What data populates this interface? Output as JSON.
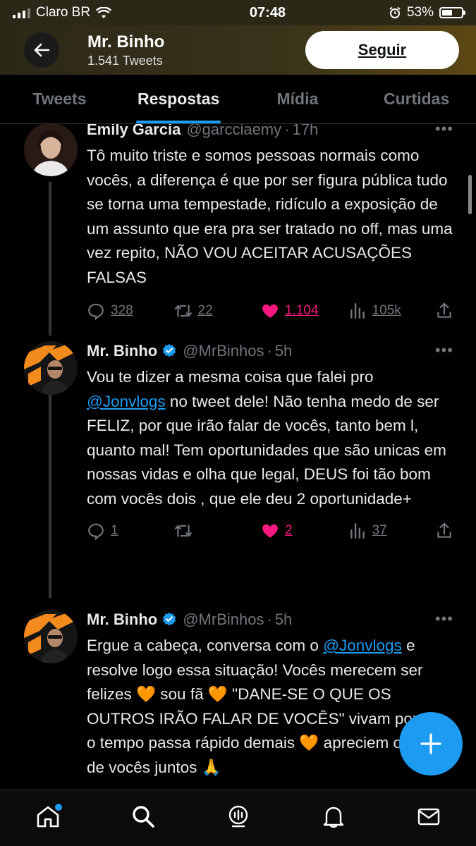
{
  "status_bar": {
    "carrier": "Claro BR",
    "time": "07:48",
    "battery": "53%",
    "battery_level": 0.53
  },
  "header": {
    "back_icon": "arrow-left-icon",
    "name": "Mr. Binho",
    "tweet_count": "1.541 Tweets",
    "follow_label": "Seguir"
  },
  "tabs": [
    {
      "label": "Tweets",
      "active": false
    },
    {
      "label": "Respostas",
      "active": true
    },
    {
      "label": "Mídia",
      "active": false
    },
    {
      "label": "Curtidas",
      "active": false
    }
  ],
  "tweets": [
    {
      "name": "Emily Garcia",
      "handle": "@garcciaemy",
      "time": "17h",
      "text": "Tô muito triste e somos pessoas normais como vocês, a diferença é que por ser figura pública tudo se torna uma tempestade, ridículo a exposição de um assunto que era pra ser tratado no off, mas uma vez repito, NÃO VOU ACEITAR ACUSAÇÕES FALSAS",
      "replies": "328",
      "retweets": "22",
      "likes": "1.104",
      "views": "105k"
    },
    {
      "name": "Mr. Binho",
      "handle": "@MrBinhos",
      "time": "5h",
      "text_before": "Vou te dizer a mesma coisa que falei pro ",
      "mention": "@Jonvlogs",
      "text_after": "  no tweet dele! Não tenha medo de ser FELIZ, por que irão falar de vocês, tanto bem l, quanto mal! Tem oportunidades que são unicas em nossas vidas e olha que legal, DEUS foi tão bom com vocês dois , que ele deu 2 oportunidade+",
      "replies": "1",
      "retweets": "",
      "likes": "2",
      "views": "37"
    },
    {
      "name": "Mr. Binho",
      "handle": "@MrBinhos",
      "time": "5h",
      "text_before": "Ergue a cabeça, conversa com o ",
      "mention": "@Jonvlogs",
      "text_after": " e resolve logo essa situação! Vocês merecem ser felizes 🧡 sou fã 🧡 \"DANE-SE O QUE OS OUTROS IRÃO FALAR DE VOCÊS\" vivam por que o tempo passa rápido demais 🧡 apreciem o tempo de vocês juntos 🙏"
    }
  ],
  "fab_icon": "plus-icon",
  "bottom_nav": [
    "home-icon",
    "search-icon",
    "spaces-icon",
    "notifications-icon",
    "messages-icon"
  ],
  "colors": {
    "accent": "#1d9bf0",
    "like": "#f91880",
    "background": "#000000",
    "muted": "#71767b"
  }
}
